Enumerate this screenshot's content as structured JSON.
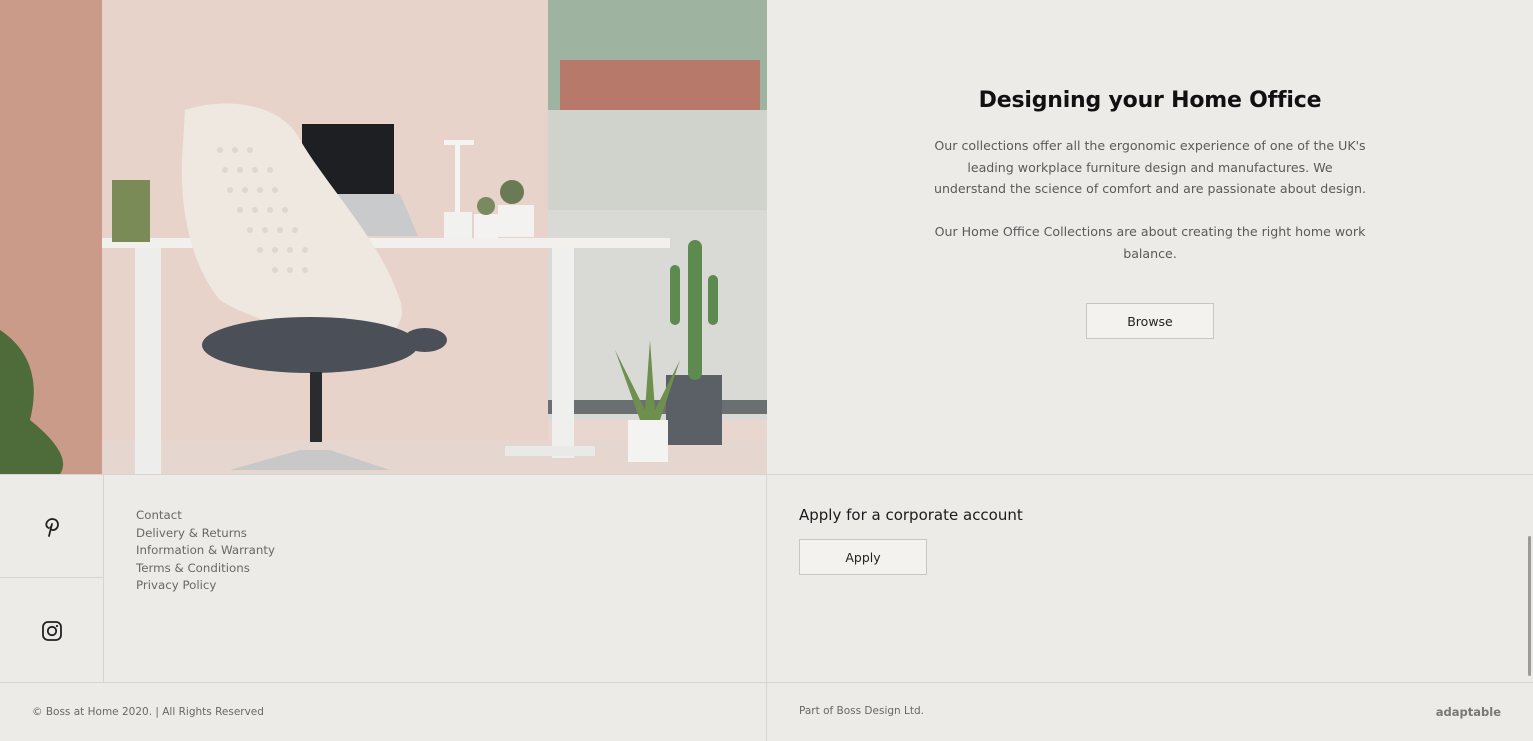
{
  "hero": {
    "image_alt": "Home office desk with white ergonomic chair, laptop and plants",
    "title": "Designing your Home Office",
    "paragraph_1": "Our collections offer all the ergonomic experience of one of the UK's leading workplace furniture design and manufactures. We understand the science of comfort and are passionate about design.",
    "paragraph_2": "Our Home Office Collections are about creating the right home work balance.",
    "browse_label": "Browse"
  },
  "footer": {
    "social": [
      {
        "icon": "pinterest-icon"
      },
      {
        "icon": "instagram-icon"
      }
    ],
    "links": [
      "Contact",
      "Delivery & Returns",
      "Information & Warranty",
      "Terms & Conditions",
      "Privacy Policy"
    ],
    "corporate_heading": "Apply for a corporate account",
    "apply_label": "Apply",
    "copyright": "© Boss at Home 2020. | All Rights Reserved",
    "part_of": "Part of Boss Design Ltd.",
    "credit": "adaptable"
  },
  "colors": {
    "background": "#edebe8",
    "divider": "#d8d5d1",
    "text_muted": "#6a6764"
  }
}
